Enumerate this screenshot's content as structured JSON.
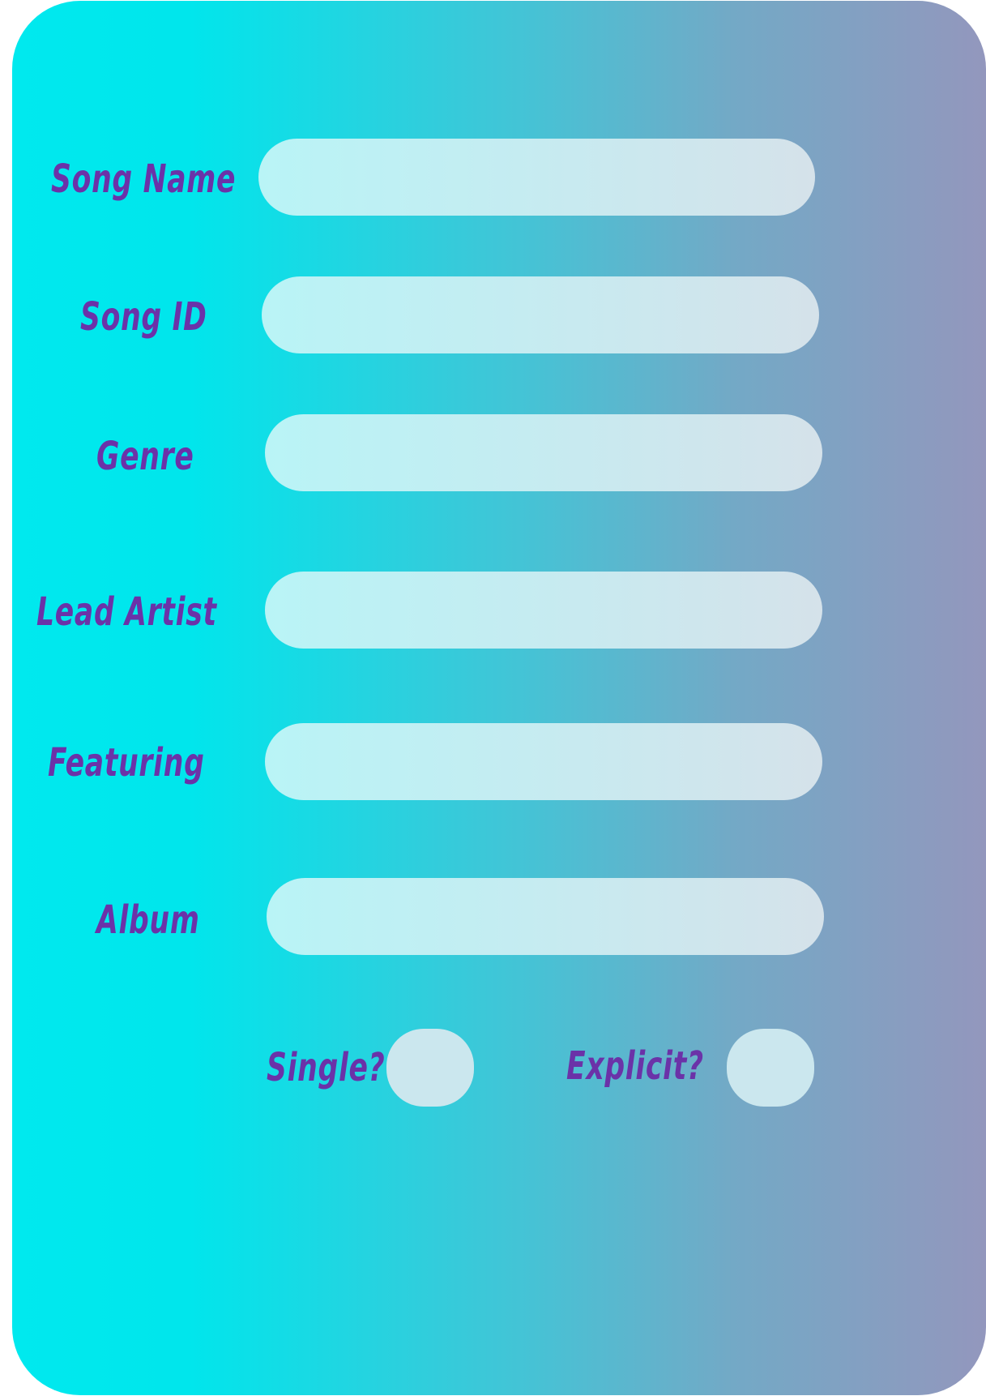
{
  "form": {
    "fields": [
      {
        "label": "Song Name",
        "value": "",
        "placeholder": ""
      },
      {
        "label": "Song ID",
        "value": "",
        "placeholder": ""
      },
      {
        "label": "Genre",
        "value": "",
        "placeholder": ""
      },
      {
        "label": "Lead Artist",
        "value": "",
        "placeholder": ""
      },
      {
        "label": "Featuring",
        "value": "",
        "placeholder": ""
      },
      {
        "label": "Album",
        "value": "",
        "placeholder": ""
      }
    ],
    "toggles": [
      {
        "label": "Single?",
        "checked": false
      },
      {
        "label": "Explicit?",
        "checked": false
      }
    ]
  },
  "colors": {
    "label_text": "#6b32a8",
    "gradient_start": "#00e9ee",
    "gradient_end": "#9397bd",
    "field_fill": "#c3edf2"
  }
}
